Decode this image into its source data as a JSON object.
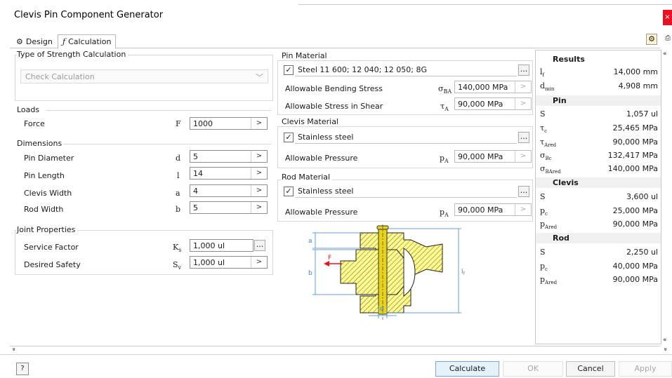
{
  "window": {
    "title": "Clevis Pin Component Generator",
    "close_glyph": "×"
  },
  "tabs": [
    {
      "label": "Design",
      "icon": "design-icon"
    },
    {
      "label": "Calculation",
      "icon": "calculation-fx-icon"
    }
  ],
  "strength": {
    "legend": "Type of Strength Calculation",
    "selected": "Check Calculation"
  },
  "loads": {
    "legend": "Loads",
    "force": {
      "label": "Force",
      "symbol": "F",
      "value": "1000"
    }
  },
  "dimensions": {
    "legend": "Dimensions",
    "rows": [
      {
        "label": "Pin Diameter",
        "symbol": "d",
        "value": "5"
      },
      {
        "label": "Pin Length",
        "symbol": "l",
        "value": "14"
      },
      {
        "label": "Clevis Width",
        "symbol": "a",
        "value": "4"
      },
      {
        "label": "Rod Width",
        "symbol": "b",
        "value": "5"
      }
    ]
  },
  "joint": {
    "legend": "Joint Properties",
    "service": {
      "label": "Service Factor",
      "symbol": "K",
      "sub": "s",
      "value": "1,000 ul"
    },
    "safety": {
      "label": "Desired Safety",
      "symbol": "S",
      "sub": "v",
      "value": "1,000 ul"
    }
  },
  "pin_material": {
    "legend": "Pin Material",
    "material": "Steel 11 600; 12 040; 12 050; 8G",
    "bending": {
      "label": "Allowable Bending Stress",
      "symbol": "σ",
      "sub": "BA",
      "value": "140,000 MPa"
    },
    "shear": {
      "label": "Allowable Stress in Shear",
      "symbol": "τ",
      "sub": "A",
      "value": "90,000 MPa"
    }
  },
  "clevis_material": {
    "legend": "Clevis Material",
    "material": "Stainless steel",
    "pressure": {
      "label": "Allowable Pressure",
      "symbol": "p",
      "sub": "A",
      "value": "90,000 MPa"
    }
  },
  "rod_material": {
    "legend": "Rod Material",
    "material": "Stainless steel",
    "pressure": {
      "label": "Allowable Pressure",
      "symbol": "p",
      "sub": "A",
      "value": "90,000 MPa"
    }
  },
  "diagram": {
    "a": "a",
    "b": "b",
    "F": "F",
    "lf": "l",
    "lf_sub": "f",
    "d": "d"
  },
  "results": {
    "header": "Results",
    "general": [
      {
        "sym": "l",
        "sub": "f",
        "value": "14,000 mm"
      },
      {
        "sym": "d",
        "sub": "min",
        "value": "4,908 mm"
      }
    ],
    "pin_label": "Pin",
    "pin": [
      {
        "sym": "S",
        "sub": "",
        "value": "1,057 ul"
      },
      {
        "sym": "τ",
        "sub": "c",
        "value": "25,465 MPa"
      },
      {
        "sym": "τ",
        "sub": "Ared",
        "value": "90,000 MPa"
      },
      {
        "sym": "σ",
        "sub": "Bc",
        "value": "132,417 MPa"
      },
      {
        "sym": "σ",
        "sub": "BAred",
        "value": "140,000 MPa"
      }
    ],
    "clevis_label": "Clevis",
    "clevis": [
      {
        "sym": "S",
        "sub": "",
        "value": "3,600 ul"
      },
      {
        "sym": "p",
        "sub": "c",
        "value": "25,000 MPa"
      },
      {
        "sym": "p",
        "sub": "Ared",
        "value": "90,000 MPa"
      }
    ],
    "rod_label": "Rod",
    "rod": [
      {
        "sym": "S",
        "sub": "",
        "value": "2,250 ul"
      },
      {
        "sym": "p",
        "sub": "c",
        "value": "40,000 MPa"
      },
      {
        "sym": "p",
        "sub": "Ared",
        "value": "90,000 MPa"
      }
    ]
  },
  "buttons": {
    "help": "?",
    "calculate": "Calculate",
    "ok": "OK",
    "cancel": "Cancel",
    "apply": "Apply"
  },
  "glyphs": {
    "arrow": ">",
    "dots": "...",
    "check": "✓",
    "chevron": "﹀",
    "collapse": "«",
    "expand": "»"
  }
}
